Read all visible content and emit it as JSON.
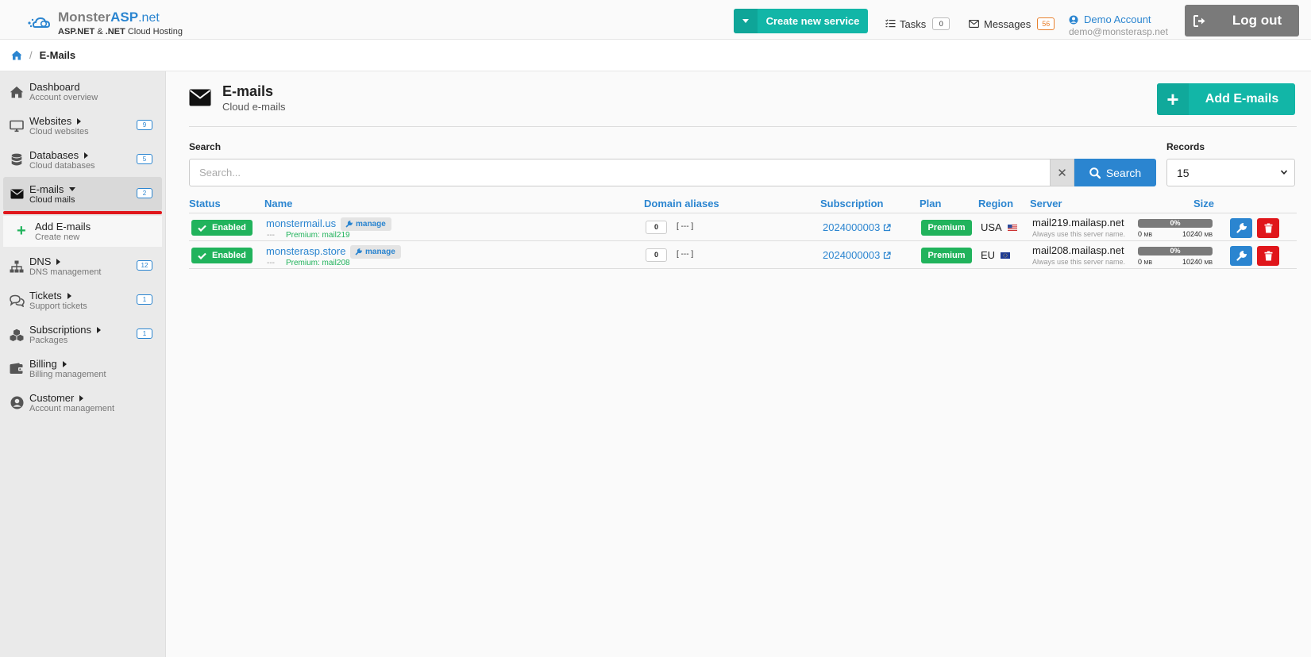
{
  "brand": {
    "name_part1": "Monster",
    "name_part2": "ASP",
    "name_part3": ".net",
    "tagline_bold": "ASP.NET",
    "tagline_mid": " & ",
    "tagline_bold2": ".NET",
    "tagline_rest": " Cloud Hosting"
  },
  "header": {
    "create_label": "Create new service",
    "tasks_label": "Tasks",
    "tasks_count": "0",
    "messages_label": "Messages",
    "messages_count": "56",
    "account_name": "Demo Account",
    "account_email": "demo@monsterasp.net",
    "logout_label": "Log out"
  },
  "breadcrumb": {
    "separator": "/",
    "current": "E-Mails"
  },
  "sidebar": {
    "items": [
      {
        "title": "Dashboard",
        "subtitle": "Account overview",
        "badge": ""
      },
      {
        "title": "Websites",
        "subtitle": "Cloud websites",
        "badge": "9"
      },
      {
        "title": "Databases",
        "subtitle": "Cloud databases",
        "badge": "5"
      },
      {
        "title": "E-mails",
        "subtitle": "Cloud mails",
        "badge": "2"
      },
      {
        "title": "DNS",
        "subtitle": "DNS management",
        "badge": "12"
      },
      {
        "title": "Tickets",
        "subtitle": "Support tickets",
        "badge": "1"
      },
      {
        "title": "Subscriptions",
        "subtitle": "Packages",
        "badge": "1"
      },
      {
        "title": "Billing",
        "subtitle": "Billing management",
        "badge": ""
      },
      {
        "title": "Customer",
        "subtitle": "Account management",
        "badge": ""
      }
    ],
    "subitem": {
      "title": "Add E-mails",
      "subtitle": "Create new"
    }
  },
  "page": {
    "title": "E-mails",
    "subtitle": "Cloud e-mails",
    "add_label": "Add E-mails"
  },
  "search": {
    "label": "Search",
    "placeholder": "Search...",
    "clear_symbol": "✕",
    "button_label": "Search",
    "records_label": "Records",
    "records_value": "15"
  },
  "table": {
    "columns": [
      "Status",
      "Name",
      "Domain aliases",
      "Subscription",
      "Plan",
      "Region",
      "Server",
      "Size"
    ],
    "rows": [
      {
        "status": "Enabled",
        "name": "monstermail.us",
        "manage": "manage",
        "sub_dash": "---",
        "sub_plan": "Premium: mail219",
        "alias_count": "0",
        "alias_list": "[ --- ]",
        "subscription": "2024000003",
        "plan": "Premium",
        "region": "USA",
        "server": "mail219.mailasp.net",
        "server_note": "Always use this server name.",
        "usage_pct": "0%",
        "used": "0",
        "used_unit": "MB",
        "total": "10240",
        "total_unit": "MB"
      },
      {
        "status": "Enabled",
        "name": "monsterasp.store",
        "manage": "manage",
        "sub_dash": "---",
        "sub_plan": "Premium: mail208",
        "alias_count": "0",
        "alias_list": "[ --- ]",
        "subscription": "2024000003",
        "plan": "Premium",
        "region": "EU",
        "server": "mail208.mailasp.net",
        "server_note": "Always use this server name.",
        "usage_pct": "0%",
        "used": "0",
        "used_unit": "MB",
        "total": "10240",
        "total_unit": "MB"
      }
    ]
  },
  "colors": {
    "accent_teal": "#12b6a7",
    "link_blue": "#2b85d0",
    "success_green": "#21b35c",
    "danger_red": "#e0161b"
  },
  "icons": {
    "logo": "cloud-logo-icon",
    "tasks": "list-check-icon",
    "messages": "envelope-icon",
    "account": "user-circle-icon",
    "logout": "sign-out-icon",
    "home": "home-icon"
  }
}
